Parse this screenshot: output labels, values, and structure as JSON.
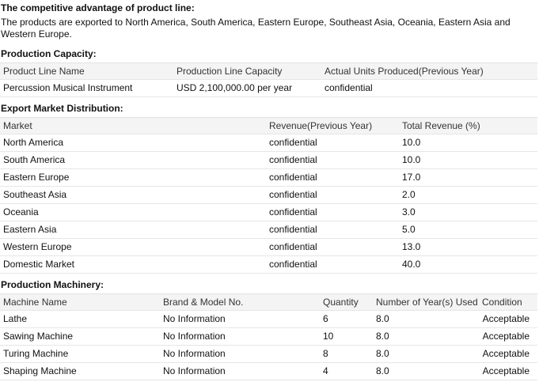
{
  "competitive": {
    "title": "The competitive advantage of product line:",
    "text": "The products are exported to North America, South America, Eastern Europe, Southeast Asia, Oceania, Eastern Asia and Western Europe."
  },
  "capacity": {
    "title": "Production Capacity:",
    "headers": [
      "Product Line Name",
      "Production Line Capacity",
      "Actual Units Produced(Previous Year)"
    ],
    "rows": [
      [
        "Percussion Musical Instrument",
        "USD 2,100,000.00 per year",
        "confidential"
      ]
    ]
  },
  "export": {
    "title": "Export Market Distribution:",
    "headers": [
      "Market",
      "Revenue(Previous Year)",
      "Total Revenue (%)"
    ],
    "rows": [
      [
        "North America",
        "confidential",
        "10.0"
      ],
      [
        "South America",
        "confidential",
        "10.0"
      ],
      [
        "Eastern Europe",
        "confidential",
        "17.0"
      ],
      [
        "Southeast Asia",
        "confidential",
        "2.0"
      ],
      [
        "Oceania",
        "confidential",
        "3.0"
      ],
      [
        "Eastern Asia",
        "confidential",
        "5.0"
      ],
      [
        "Western Europe",
        "confidential",
        "13.0"
      ],
      [
        "Domestic Market",
        "confidential",
        "40.0"
      ]
    ]
  },
  "machinery": {
    "title": "Production Machinery:",
    "headers": [
      "Machine Name",
      "Brand & Model No.",
      "Quantity",
      "Number of Year(s) Used",
      "Condition"
    ],
    "rows": [
      [
        "Lathe",
        "No Information",
        "6",
        "8.0",
        "Acceptable"
      ],
      [
        "Sawing Machine",
        "No Information",
        "10",
        "8.0",
        "Acceptable"
      ],
      [
        "Turing Machine",
        "No Information",
        "8",
        "8.0",
        "Acceptable"
      ],
      [
        "Shaping Machine",
        "No Information",
        "4",
        "8.0",
        "Acceptable"
      ]
    ]
  }
}
